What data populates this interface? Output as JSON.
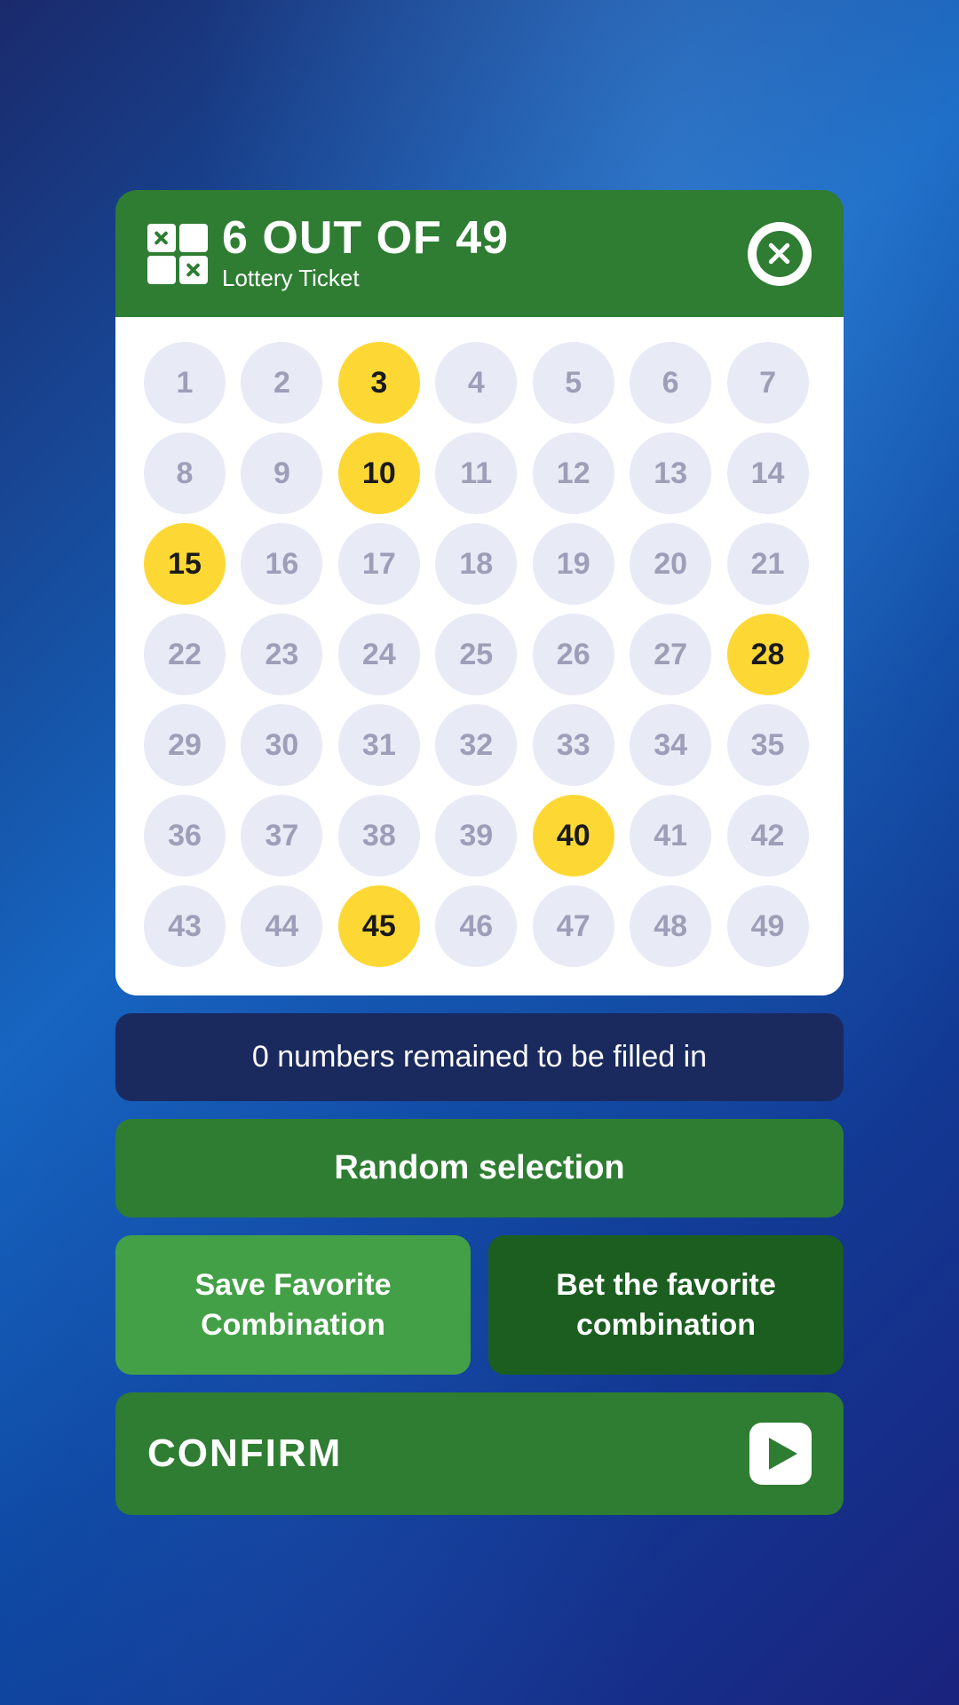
{
  "header": {
    "title": "6 OUT OF 49",
    "subtitle": "Lottery Ticket"
  },
  "numbers": {
    "total": 49,
    "selected": [
      3,
      10,
      15,
      28,
      40,
      45
    ],
    "grid": [
      1,
      2,
      3,
      4,
      5,
      6,
      7,
      8,
      9,
      10,
      11,
      12,
      13,
      14,
      15,
      16,
      17,
      18,
      19,
      20,
      21,
      22,
      23,
      24,
      25,
      26,
      27,
      28,
      29,
      30,
      31,
      32,
      33,
      34,
      35,
      36,
      37,
      38,
      39,
      40,
      41,
      42,
      43,
      44,
      45,
      46,
      47,
      48,
      49
    ]
  },
  "status": {
    "message": "0 numbers remained to be filled in"
  },
  "buttons": {
    "random": "Random selection",
    "save_favorite": "Save Favorite Combination",
    "bet_favorite": "Bet the favorite combination",
    "confirm": "CONFIRM"
  }
}
